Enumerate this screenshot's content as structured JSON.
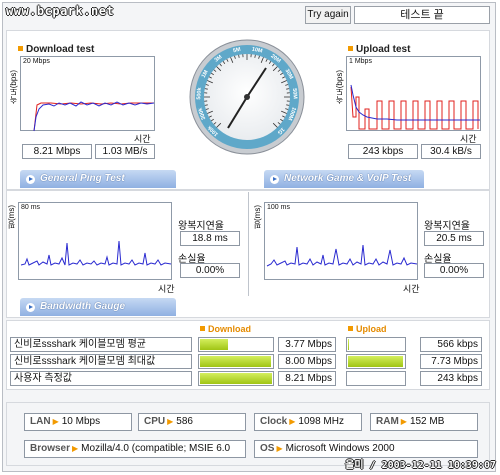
{
  "watermark": "www.bcpark.net",
  "header": {
    "try_again_label": "Try again",
    "status_text": "테스트 끝"
  },
  "download": {
    "title": "Download test",
    "y_axis_label": "속도(bps)",
    "scale_label": "20 Mbps",
    "x_axis_label": "시간",
    "value_kbps": "8.21 Mbps",
    "value_bytes": "1.03 MB/s"
  },
  "upload": {
    "title": "Upload test",
    "y_axis_label": "속도(bps)",
    "scale_label": "1 Mbps",
    "x_axis_label": "시간",
    "value_kbps": "243 kbps",
    "value_bytes": "30.4 kB/s"
  },
  "speedometer": {
    "ticks": [
      "100k",
      "300k",
      "500k",
      "1M",
      "3M",
      "5M",
      "10M",
      "20M",
      "30M",
      "50M",
      "100M",
      "1G"
    ]
  },
  "tabs": {
    "ping": "General Ping Test",
    "game": "Network Game & VoIP Test",
    "gauge": "Bandwidth Gauge"
  },
  "ping_left": {
    "y_axis_label": "핑(ms)",
    "scale_label": "80 ms",
    "x_axis_label": "시간",
    "delay_label": "왕복지연율",
    "delay_value": "18.8 ms",
    "loss_label": "손실율",
    "loss_value": "0.00%"
  },
  "ping_right": {
    "y_axis_label": "핑(ms)",
    "scale_label": "100 ms",
    "x_axis_label": "시간",
    "delay_label": "왕복지연율",
    "delay_value": "20.5 ms",
    "loss_label": "손실율",
    "loss_value": "0.00%"
  },
  "gauge": {
    "download_head": "Download",
    "upload_head": "Upload",
    "rows": [
      {
        "label": "신비로ssshark 케이블모뎀 평균",
        "down": "3.77 Mbps",
        "down_fill": 0.4,
        "up": "566 kbps",
        "up_fill": 0.05
      },
      {
        "label": "신비로ssshark 케이블모뎀 최대값",
        "down": "8.00 Mbps",
        "down_fill": 0.98,
        "up": "7.73 Mbps",
        "up_fill": 0.98
      },
      {
        "label": "사용자 측정값",
        "down": "8.21 Mbps",
        "down_fill": 1.0,
        "up": "243 kbps",
        "up_fill": 0.03
      }
    ]
  },
  "system": {
    "lan_label": "LAN",
    "lan_value": "10 Mbps",
    "cpu_label": "CPU",
    "cpu_value": "586",
    "clock_label": "Clock",
    "clock_value": "1098 MHz",
    "ram_label": "RAM",
    "ram_value": "152 MB",
    "browser_label": "Browser",
    "browser_value": "Mozilla/4.0 (compatible; MSIE 6.0",
    "os_label": "OS",
    "os_value": "Microsoft Windows 2000"
  },
  "footer_stamp": "올미 / 2003-12-11 10:39:07",
  "colors": {
    "accent": "#f29a00",
    "tab_blue": "#8fb0e2",
    "series_red": "#e0201e",
    "series_blue": "#2a2ad0",
    "gauge_green": "#b5d52a"
  }
}
